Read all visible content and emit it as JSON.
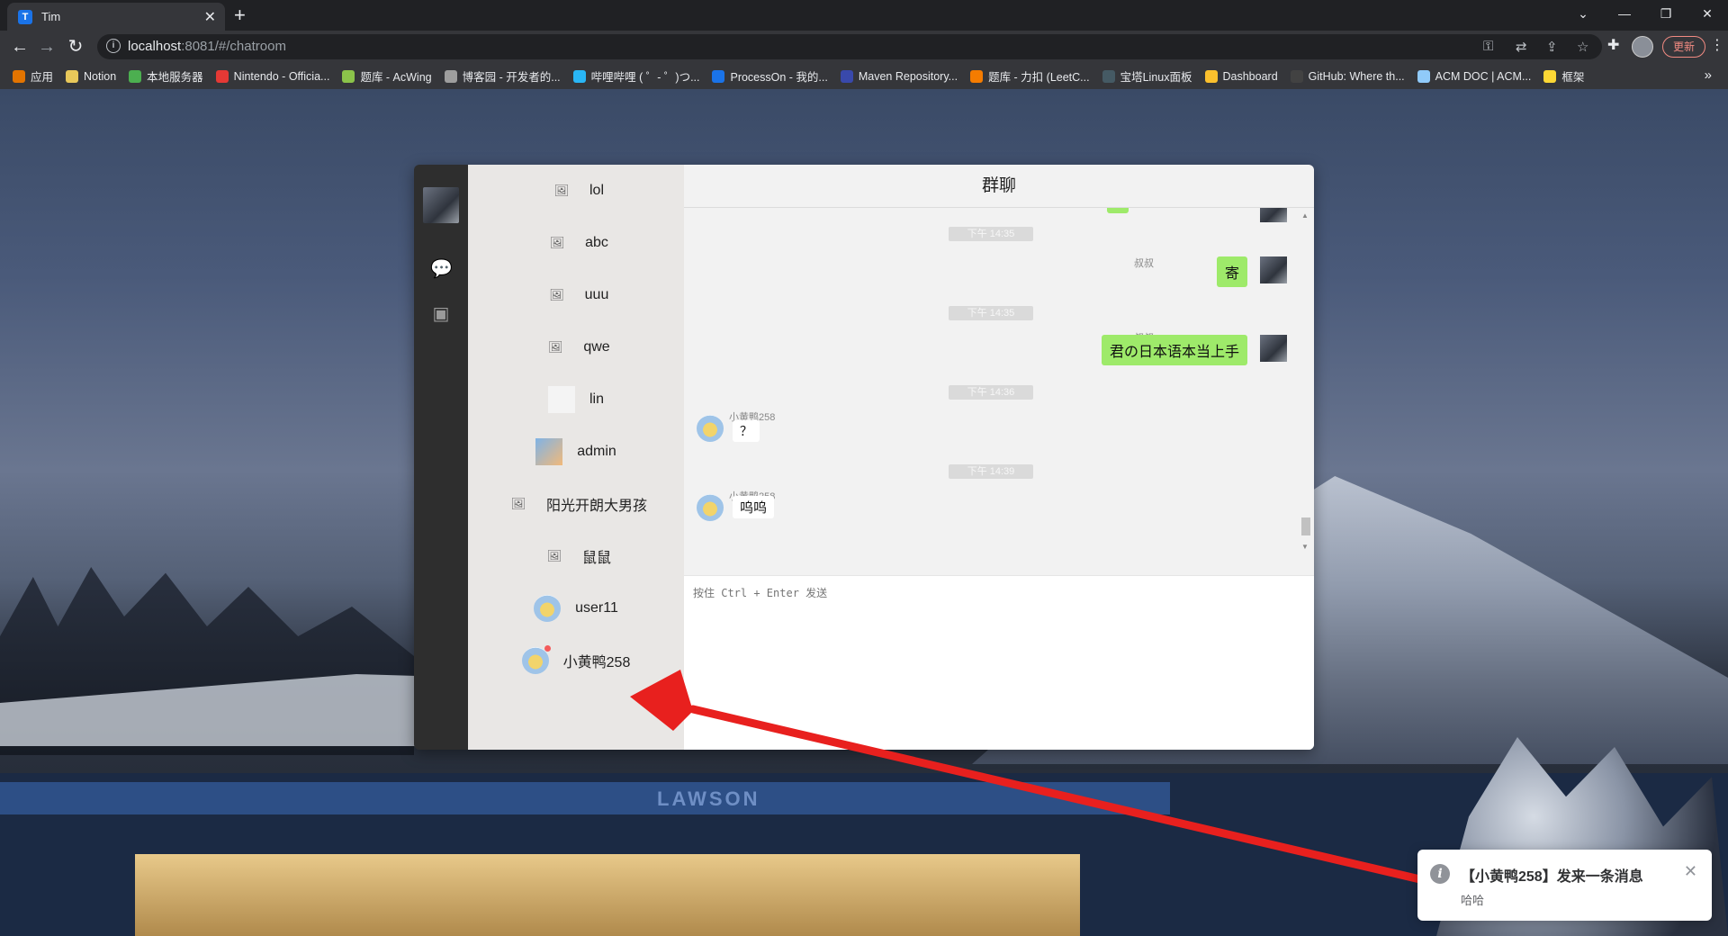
{
  "browser": {
    "tab_title": "Tim",
    "tab_favicon": "tim-favicon",
    "url_host": "localhost",
    "url_rest": ":8081/#/chatroom",
    "update_label": "更新",
    "bookmarks": [
      {
        "label": "应用",
        "color": "#e37400"
      },
      {
        "label": "Notion",
        "color": "#e8c85a"
      },
      {
        "label": "本地服务器",
        "color": "#4caf50"
      },
      {
        "label": "Nintendo - Officia...",
        "color": "#e53935"
      },
      {
        "label": "题库 - AcWing",
        "color": "#8bc34a"
      },
      {
        "label": "博客园 - 开发者的...",
        "color": "#9e9e9e"
      },
      {
        "label": "哔哩哔哩 ( ゜- ゜)つ...",
        "color": "#29b6f6"
      },
      {
        "label": "ProcessOn - 我的...",
        "color": "#1a73e8"
      },
      {
        "label": "Maven Repository...",
        "color": "#3949ab"
      },
      {
        "label": "题库 - 力扣 (LeetC...",
        "color": "#f57c00"
      },
      {
        "label": "宝塔Linux面板",
        "color": "#455a64"
      },
      {
        "label": "Dashboard",
        "color": "#fbc02d"
      },
      {
        "label": "GitHub: Where th...",
        "color": "#424242"
      },
      {
        "label": "ACM DOC | ACM...",
        "color": "#90caf9"
      },
      {
        "label": "框架",
        "color": "#fdd835"
      }
    ]
  },
  "chat": {
    "title": "群聊",
    "contacts": [
      {
        "name": "lol",
        "avatar": "broken-image"
      },
      {
        "name": "abc",
        "avatar": "broken-image"
      },
      {
        "name": "uuu",
        "avatar": "broken-image"
      },
      {
        "name": "qwe",
        "avatar": "broken-image"
      },
      {
        "name": "lin",
        "avatar": "blank"
      },
      {
        "name": "admin",
        "avatar": "photo"
      },
      {
        "name": "阳光开朗大男孩",
        "avatar": "broken-image"
      },
      {
        "name": "鼠鼠",
        "avatar": "broken-image"
      },
      {
        "name": "user11",
        "avatar": "duck"
      },
      {
        "name": "小黄鸭258",
        "avatar": "duck",
        "unread": true
      }
    ],
    "messages": {
      "t1": "下午 14:35",
      "m1_user": "叔叔",
      "m1_text": "寄",
      "t2": "下午 14:35",
      "m2_user": "叔叔",
      "m2_text": "君の日本语本当上手",
      "t3": "下午 14:36",
      "m3_user": "小黄鸭258",
      "m3_text": "？",
      "t4": "下午 14:39",
      "m4_user": "小黄鸭258",
      "m4_text": "呜呜"
    },
    "input_placeholder": "按住 Ctrl + Enter 发送"
  },
  "notification": {
    "title": "【小黄鸭258】发来一条消息",
    "body": "哈哈"
  },
  "colors": {
    "bubble_me": "#9eea6a",
    "arrow": "#e8201e",
    "sidebar": "#2e2e2e"
  }
}
